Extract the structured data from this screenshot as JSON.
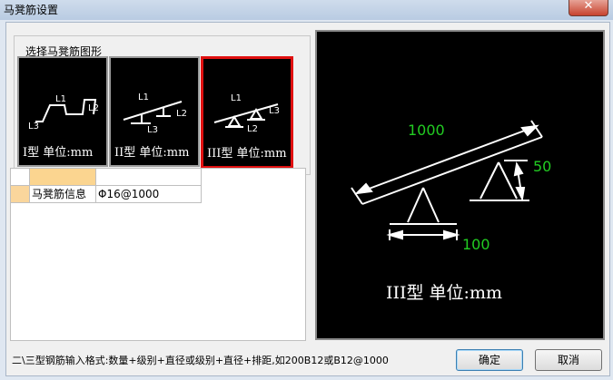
{
  "window": {
    "title": "马凳筋设置",
    "close_glyph": "✕"
  },
  "shape_group": {
    "label": "选择马凳筋图形",
    "options": [
      {
        "caption": "I型 单位:mm",
        "selected": false
      },
      {
        "caption": "II型 单位:mm",
        "selected": false
      },
      {
        "caption": "III型 单位:mm",
        "selected": true
      }
    ],
    "labels": {
      "l1": "L1",
      "l2": "L2",
      "l3": "L3"
    }
  },
  "grid": {
    "rows": [
      {
        "name": "马凳筋信息",
        "value": "Φ16@1000"
      }
    ]
  },
  "preview": {
    "dim_top": "1000",
    "dim_right": "50",
    "dim_bottom": "100",
    "caption": "III型 单位:mm",
    "dim_color": "#22cc22",
    "line_color": "#ffffff"
  },
  "footer": {
    "hint": "二\\三型钢筋输入格式:数量+级别+直径或级别+直径+排距,如200B12或B12@1000",
    "ok_label": "确定",
    "cancel_label": "取消"
  }
}
